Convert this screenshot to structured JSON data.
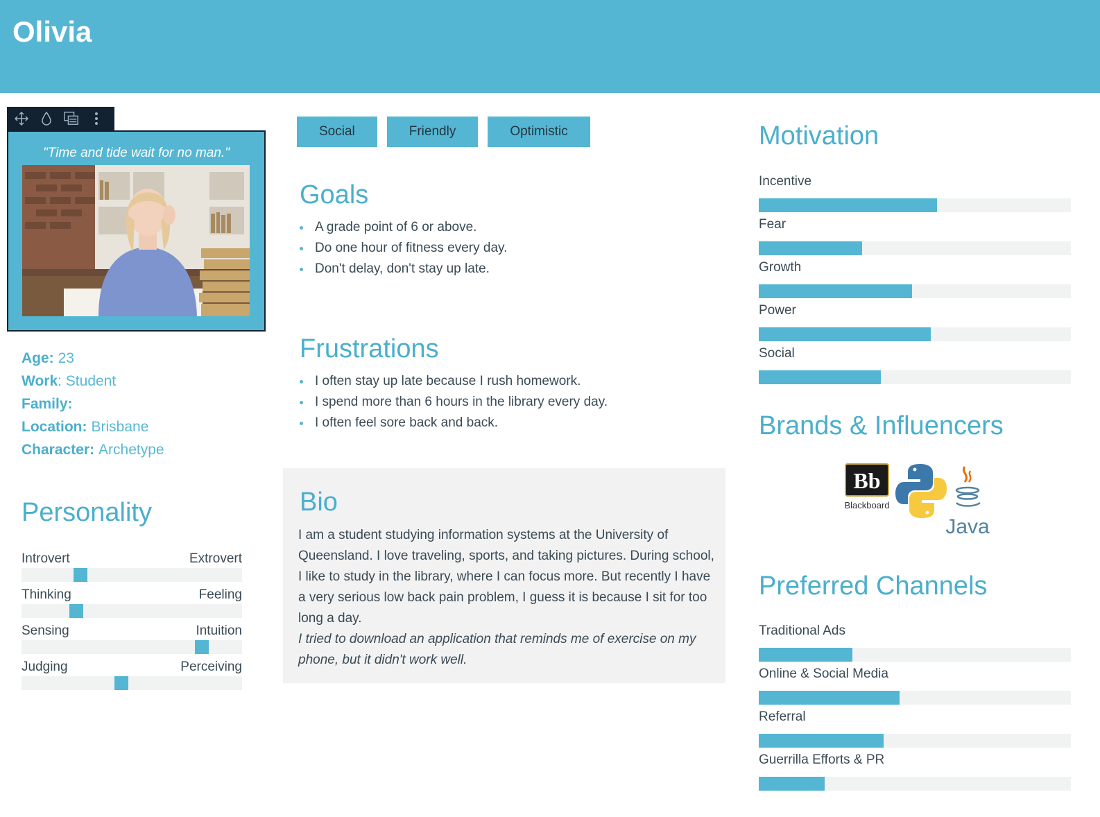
{
  "persona": {
    "name": "Olivia"
  },
  "toolbar": {
    "icons": [
      "move-icon",
      "droplet-icon",
      "image-layers-icon",
      "more-vertical-icon"
    ]
  },
  "quote": "\"Time and tide wait for no man.\"",
  "facts": {
    "age_label": "Age:",
    "age_value": "23",
    "work_label": "Work",
    "work_value": ": Student",
    "family_label": "Family:",
    "family_value": "",
    "location_label": "Location:",
    "location_value": "Brisbane",
    "character_label": "Character:",
    "character_value": "Archetype"
  },
  "personality": {
    "title": "Personality",
    "scales": [
      {
        "left": "Introvert",
        "right": "Extrovert",
        "level": 0.25
      },
      {
        "left": "Thinking",
        "right": "Feeling",
        "level": 0.23
      },
      {
        "left": "Sensing",
        "right": "Intuition",
        "level": 0.84
      },
      {
        "left": "Judging",
        "right": "Perceiving",
        "level": 0.45
      }
    ]
  },
  "tags": [
    "Social",
    "Friendly",
    "Optimistic"
  ],
  "goals": {
    "title": "Goals",
    "items": [
      "A grade point of 6 or above.",
      "Do one hour of fitness every day.",
      "Don't delay, don't stay up late."
    ]
  },
  "frustrations": {
    "title": "Frustrations",
    "items": [
      "I often stay up late because I rush homework.",
      "I spend more than 6 hours in the library every day.",
      "I often feel sore back and back."
    ]
  },
  "bio": {
    "title": "Bio",
    "text": "I am a student studying information systems at the University of Queensland. I love traveling, sports, and taking pictures. During school, I like to study in the library, where I can focus more. But recently I have a very serious low back pain problem, I guess it is because I sit for too long a day.",
    "italic_text": "I tried to download an application that reminds me of exercise on my phone, but it didn't work well."
  },
  "motivation": {
    "title": "Motivation",
    "bars": [
      {
        "label": "Incentive",
        "level": 0.57
      },
      {
        "label": "Fear",
        "level": 0.33
      },
      {
        "label": "Growth",
        "level": 0.49
      },
      {
        "label": "Power",
        "level": 0.55
      },
      {
        "label": "Social",
        "level": 0.39
      }
    ]
  },
  "brands": {
    "title": "Brands & Influencers",
    "blackboard_caption": "Blackboard",
    "java_caption": "Java"
  },
  "channels": {
    "title": "Preferred Channels",
    "bars": [
      {
        "label": "Traditional Ads",
        "level": 0.3
      },
      {
        "label": "Online & Social Media",
        "level": 0.45
      },
      {
        "label": "Referral",
        "level": 0.4
      },
      {
        "label": "Guerrilla Efforts & PR",
        "level": 0.21
      }
    ]
  },
  "colors": {
    "accent": "#54b6d2",
    "accent_text": "#4aafcc",
    "toolbar": "#132230",
    "track": "#f1f2f2"
  }
}
